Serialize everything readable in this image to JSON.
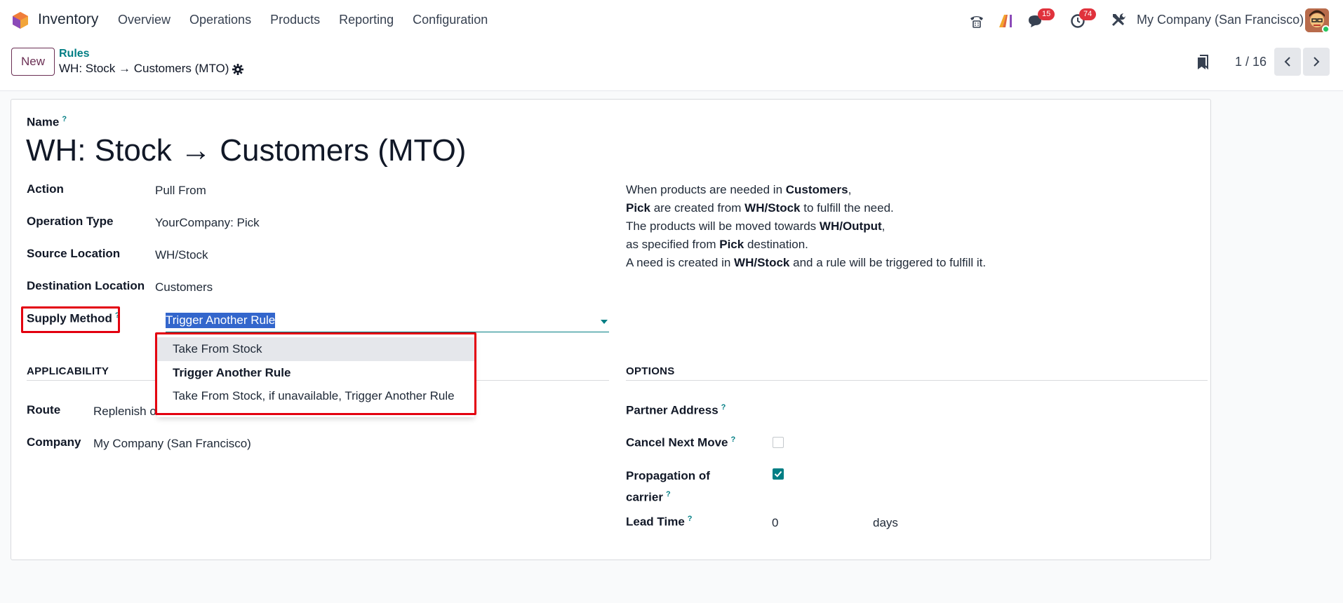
{
  "app": {
    "name": "Inventory"
  },
  "menu": [
    "Overview",
    "Operations",
    "Products",
    "Reporting",
    "Configuration"
  ],
  "systray": {
    "messages_count": "15",
    "activities_count": "74",
    "company": "My Company (San Francisco)"
  },
  "control": {
    "new_label": "New",
    "breadcrumb_parent": "Rules",
    "breadcrumb_current": "WH: Stock → Customers (MTO)",
    "pager": "1 / 16"
  },
  "form": {
    "name_label": "Name",
    "name_value": "WH: Stock → Customers (MTO)",
    "action_label": "Action",
    "action_value": "Pull From",
    "operation_type_label": "Operation Type",
    "operation_type_value": "YourCompany: Pick",
    "source_location_label": "Source Location",
    "source_location_value": "WH/Stock",
    "destination_location_label": "Destination Location",
    "destination_location_value": "Customers",
    "supply_method_label": "Supply Method",
    "supply_method_value": "Trigger Another Rule",
    "supply_method_options": [
      "Take From Stock",
      "Trigger Another Rule",
      "Take From Stock, if unavailable, Trigger Another Rule"
    ],
    "applicability_title": "APPLICABILITY",
    "route_label": "Route",
    "route_value": "Replenish o",
    "company_label": "Company",
    "company_value": "My Company (San Francisco)",
    "options_title": "OPTIONS",
    "partner_address_label": "Partner Address",
    "cancel_next_move_label": "Cancel Next Move",
    "cancel_next_move_checked": false,
    "propagation_label_1": "Propagation of",
    "propagation_label_2": "carrier",
    "propagation_checked": true,
    "lead_time_label": "Lead Time",
    "lead_time_value": "0",
    "lead_time_unit": "days"
  },
  "explanation": {
    "l1_a": "When products are needed in ",
    "l1_b": "Customers",
    "l1_c": ",",
    "l2_a": "Pick",
    "l2_b": " are created from ",
    "l2_c": "WH/Stock",
    "l2_d": " to fulfill the need.",
    "l3_a": "The products will be moved towards ",
    "l3_b": "WH/Output",
    "l3_c": ",",
    "l4_a": "as specified from ",
    "l4_b": "Pick",
    "l4_c": " destination.",
    "l5_a": "A need is created in ",
    "l5_b": "WH/Stock",
    "l5_c": " and a rule will be triggered to fulfill it."
  },
  "colors": {
    "brand": "#6b3054",
    "accent": "#017e84",
    "highlight": "#e3000f"
  }
}
